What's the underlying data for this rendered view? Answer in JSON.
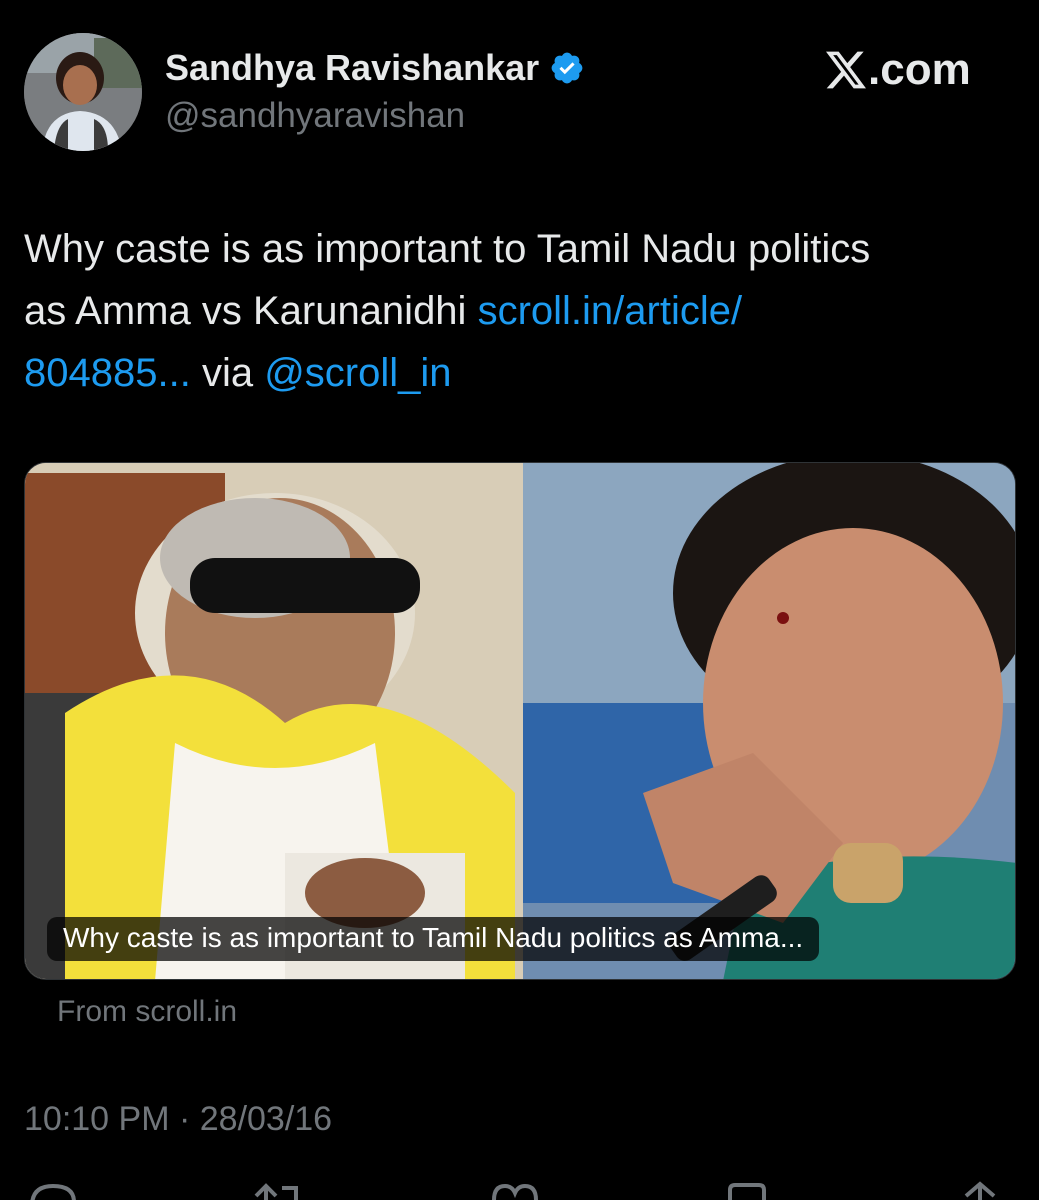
{
  "author": {
    "display_name": "Sandhya Ravishankar",
    "handle": "@sandhyaravishan",
    "verified": true
  },
  "site": {
    "brand": ".com",
    "logo_icon": "x-logo-icon"
  },
  "tweet": {
    "line1": "Why caste is as important to Tamil Nadu politics",
    "line2_text": "as Amma vs Karunanidhi ",
    "link_part1": "scroll.in/article/",
    "link_part2": "804885...",
    "via_text": " via ",
    "mention": "@scroll_in"
  },
  "card": {
    "caption": "Why caste is as important to Tamil Nadu politics as Amma...",
    "source": "From scroll.in"
  },
  "meta": {
    "timestamp": "10:10 PM · 28/03/16"
  },
  "actions": {
    "icons": [
      "reply-icon",
      "retweet-icon",
      "like-icon",
      "bookmark-icon",
      "share-icon"
    ]
  },
  "colors": {
    "background": "#000000",
    "text": "#e7e9ea",
    "secondary": "#71767b",
    "link": "#1d9bf0",
    "verified": "#1d9bf0"
  }
}
